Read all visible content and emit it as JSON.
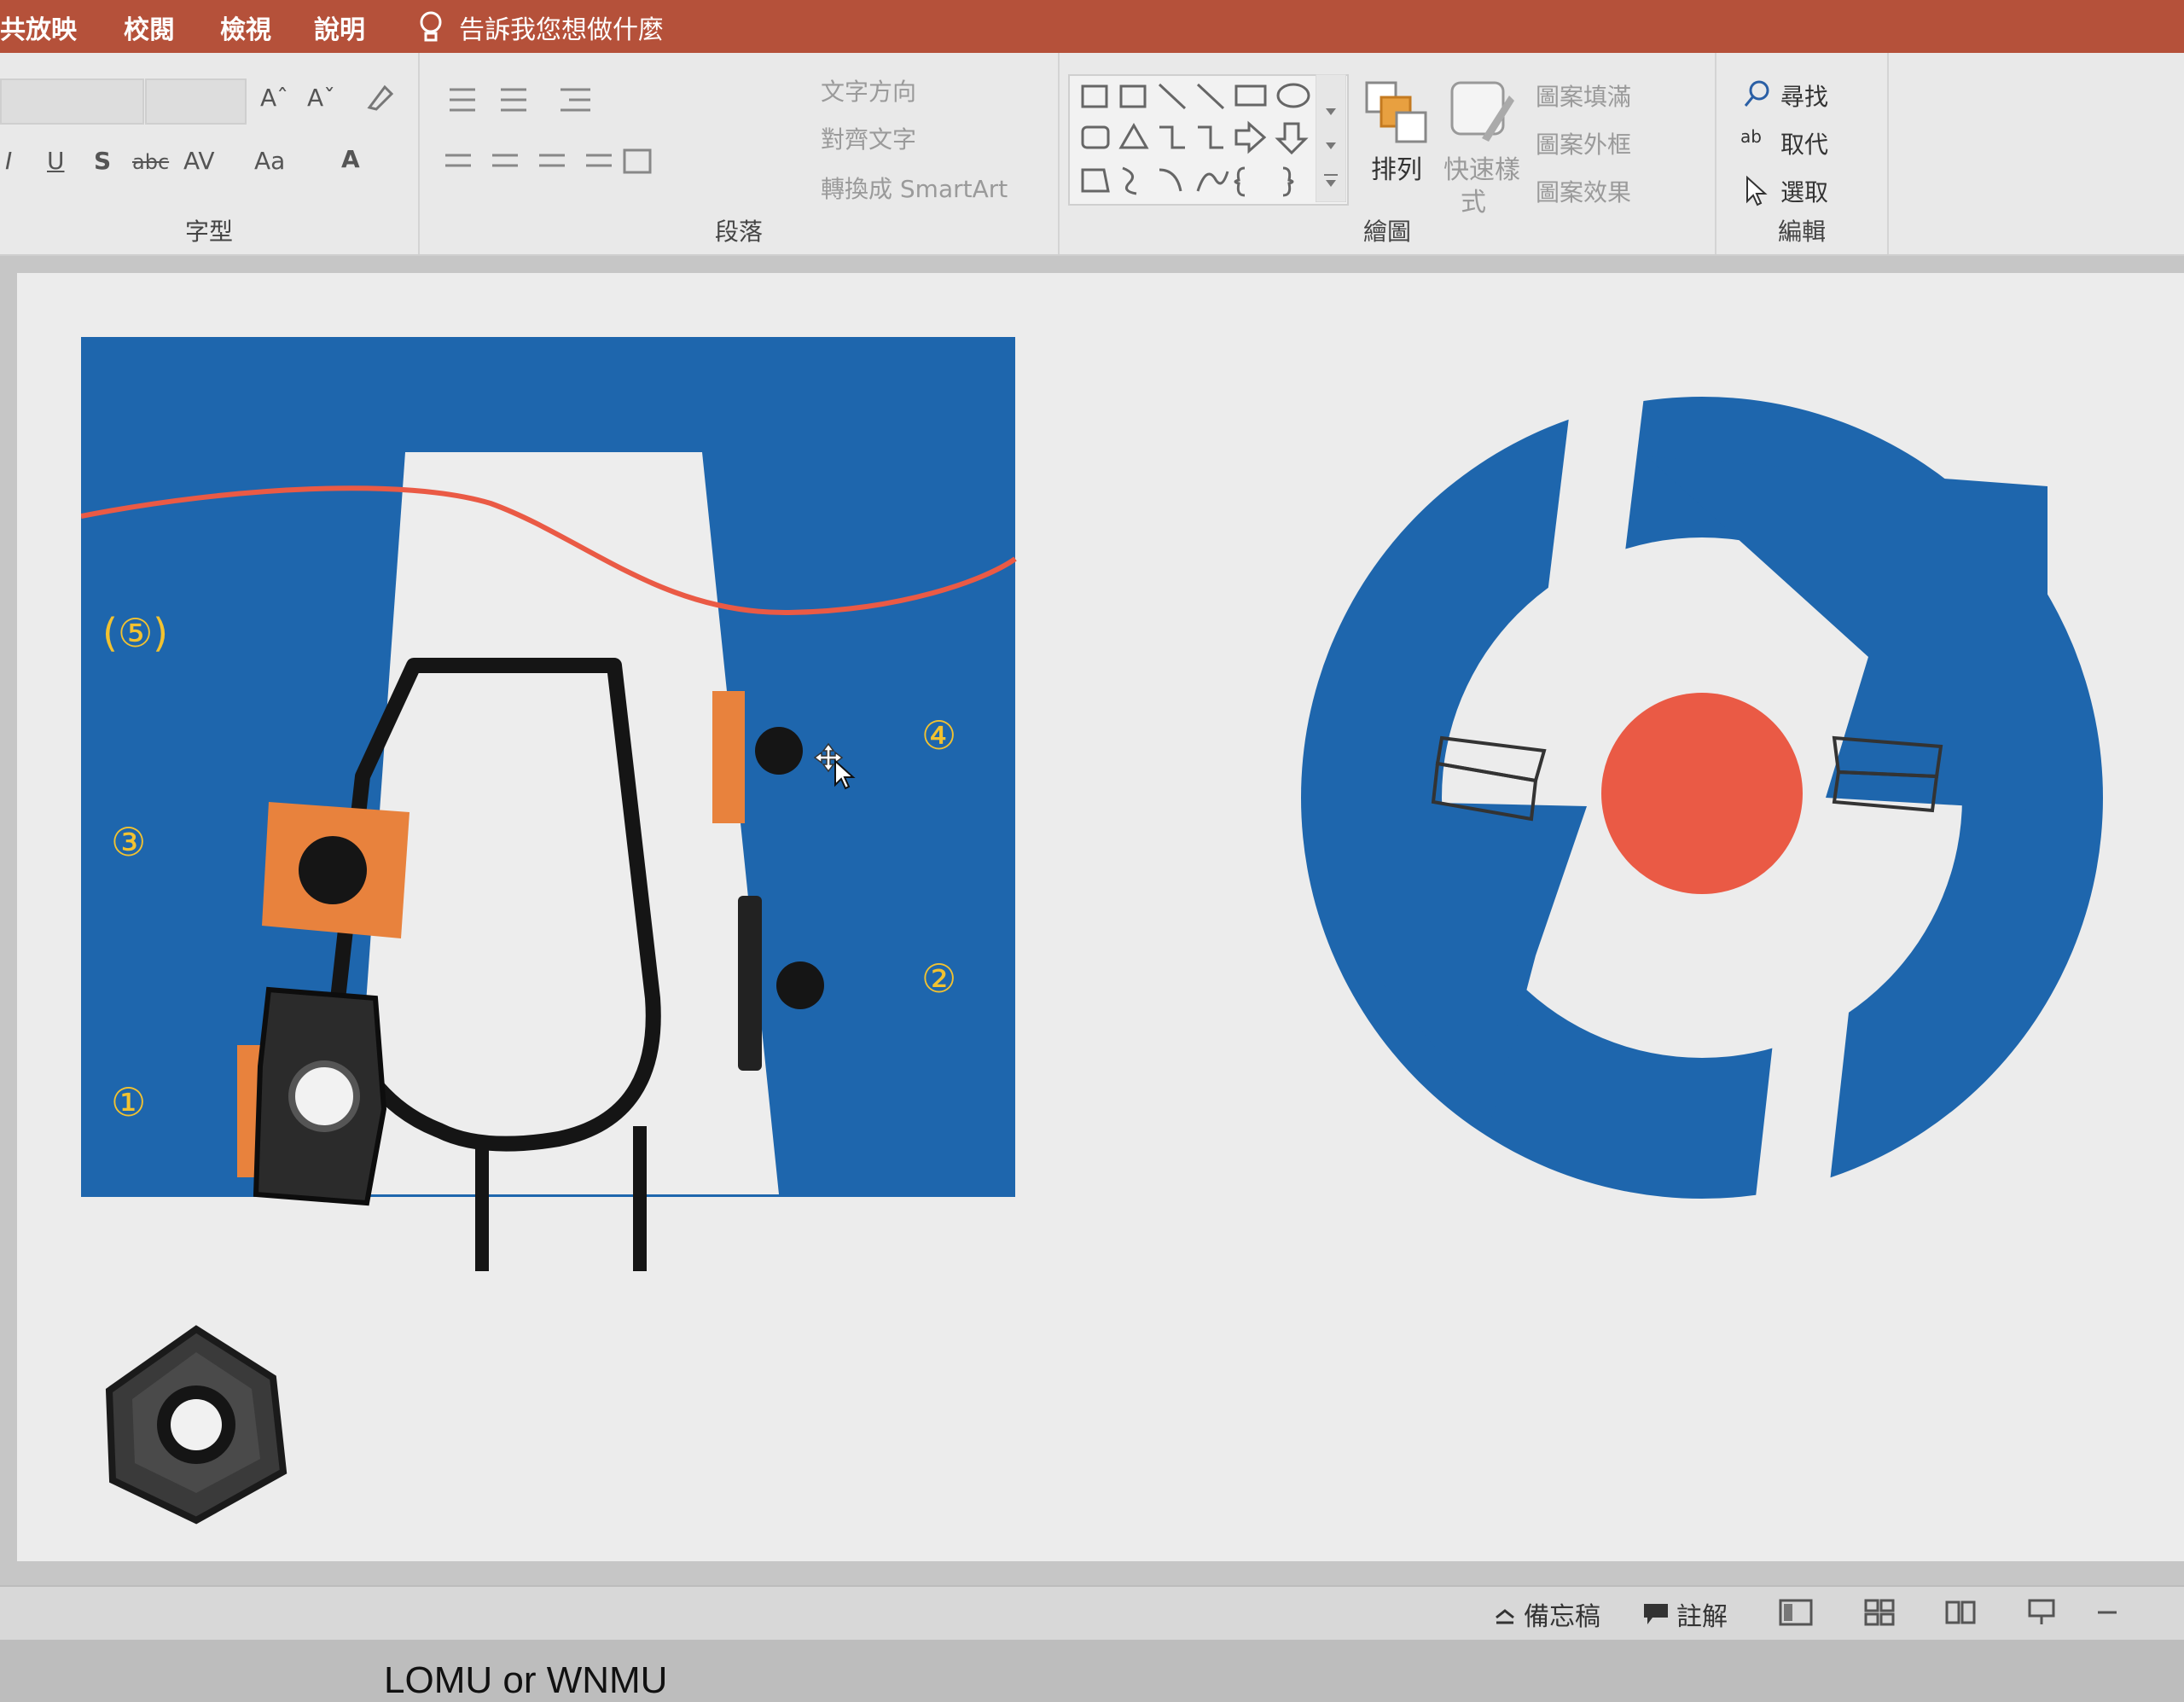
{
  "menu": {
    "tabs": [
      "共放映",
      "校閱",
      "檢視",
      "說明"
    ],
    "tell_me": "告訴我您想做什麼"
  },
  "ribbon": {
    "font": {
      "label": "字型",
      "grow": "Aˆ",
      "shrink": "Aˇ",
      "italic": "I",
      "underline": "U",
      "shadow": "S",
      "strike": "abc",
      "spacing": "AV",
      "case": "Aa",
      "color": "A"
    },
    "paragraph": {
      "label": "段落",
      "text_direction": "文字方向",
      "align_text": "對齊文字",
      "convert_smartart": "轉換成 SmartArt"
    },
    "drawing": {
      "label": "繪圖",
      "arrange": "排列",
      "quick_styles_1": "快速樣",
      "quick_styles_2": "式",
      "shape_fill": "圖案填滿",
      "shape_outline": "圖案外框",
      "shape_effects": "圖案效果"
    },
    "editing": {
      "label": "編輯",
      "find": "尋找",
      "replace": "取代",
      "select": "選取"
    }
  },
  "slide": {
    "labels": {
      "n1": "①",
      "n2": "②",
      "n3": "③",
      "n4": "④",
      "n5": "(⑤)"
    },
    "caption": "LOMU or WNMU"
  },
  "status": {
    "notes": "備忘稿",
    "comments": "註解"
  },
  "colors": {
    "blue": "#1e66ad",
    "orange": "#e8823d",
    "red": "#ea5a45",
    "yellow": "#f2c230",
    "title_bar": "#b5513a"
  }
}
